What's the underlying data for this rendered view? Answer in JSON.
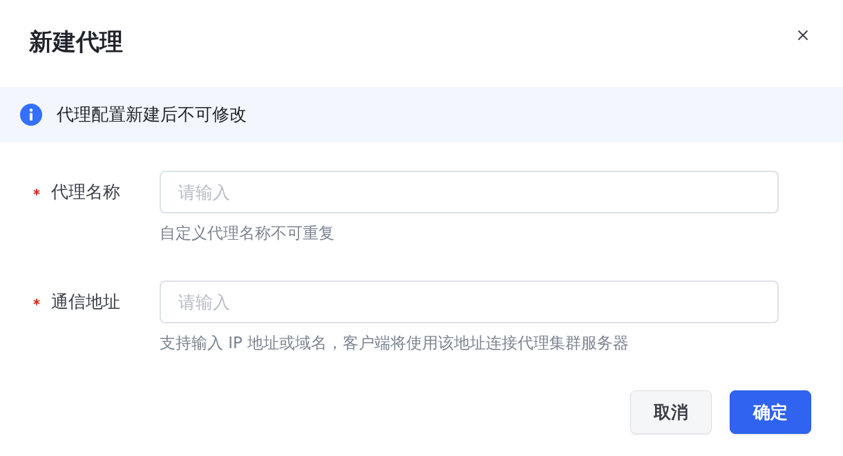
{
  "dialog": {
    "title": "新建代理"
  },
  "notice": {
    "kind": "info",
    "text": "代理配置新建后不可修改"
  },
  "fields": [
    {
      "label": "代理名称",
      "required": true,
      "placeholder": "请输入",
      "help": "自定义代理名称不可重复"
    },
    {
      "label": "通信地址",
      "required": true,
      "placeholder": "请输入",
      "help": "支持输入 IP 地址或域名，客户端将使用该地址连接代理集群服务器"
    }
  ],
  "buttons": [
    {
      "label": "取消",
      "kind": "secondary"
    },
    {
      "label": "确定",
      "kind": "primary"
    }
  ]
}
